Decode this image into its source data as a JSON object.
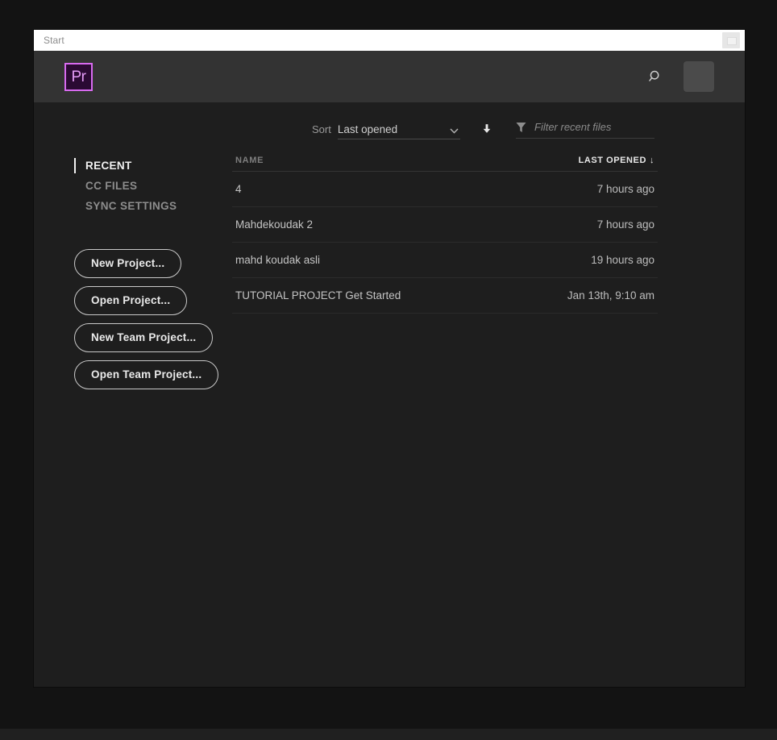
{
  "titlebar": {
    "label": "Start",
    "window_button_icon": "window-restore-icon"
  },
  "header": {
    "logo_text": "Pr",
    "logo_name": "premiere-pro-logo",
    "search_icon": "search-icon",
    "avatar_name": "avatar"
  },
  "toolbar": {
    "sort_label": "Sort",
    "sort_value": "Last opened",
    "sort_direction_icon": "arrow-down-icon",
    "chevron_icon": "chevron-down-icon",
    "filter_icon": "filter-funnel-icon",
    "filter_placeholder": "Filter recent files",
    "filter_value": ""
  },
  "sidebar": {
    "items": [
      {
        "label": "RECENT",
        "active": true
      },
      {
        "label": "CC FILES",
        "active": false
      },
      {
        "label": "SYNC SETTINGS",
        "active": false
      }
    ],
    "buttons": [
      {
        "label": "New Project..."
      },
      {
        "label": "Open Project..."
      },
      {
        "label": "New Team Project..."
      },
      {
        "label": "Open Team Project..."
      }
    ]
  },
  "recent": {
    "columns": {
      "name": "NAME",
      "last_opened": "LAST OPENED",
      "sort_arrow": "↓"
    },
    "rows": [
      {
        "name": "4",
        "last_opened": "7 hours ago"
      },
      {
        "name": "Mahdekoudak 2",
        "last_opened": "7 hours ago"
      },
      {
        "name": "mahd koudak asli",
        "last_opened": "19 hours ago"
      },
      {
        "name": "TUTORIAL PROJECT Get Started",
        "last_opened": "Jan 13th, 9:10 am"
      }
    ]
  },
  "colors": {
    "desktop_background": "#131313",
    "window_background": "#1e1e1e",
    "header_background": "#333333",
    "titlebar_background": "#ffffff",
    "accent_purple": "#d86af0",
    "logo_fill": "#2b0a33",
    "text_primary": "#f2f2f2",
    "text_secondary": "#8d8d8d"
  }
}
